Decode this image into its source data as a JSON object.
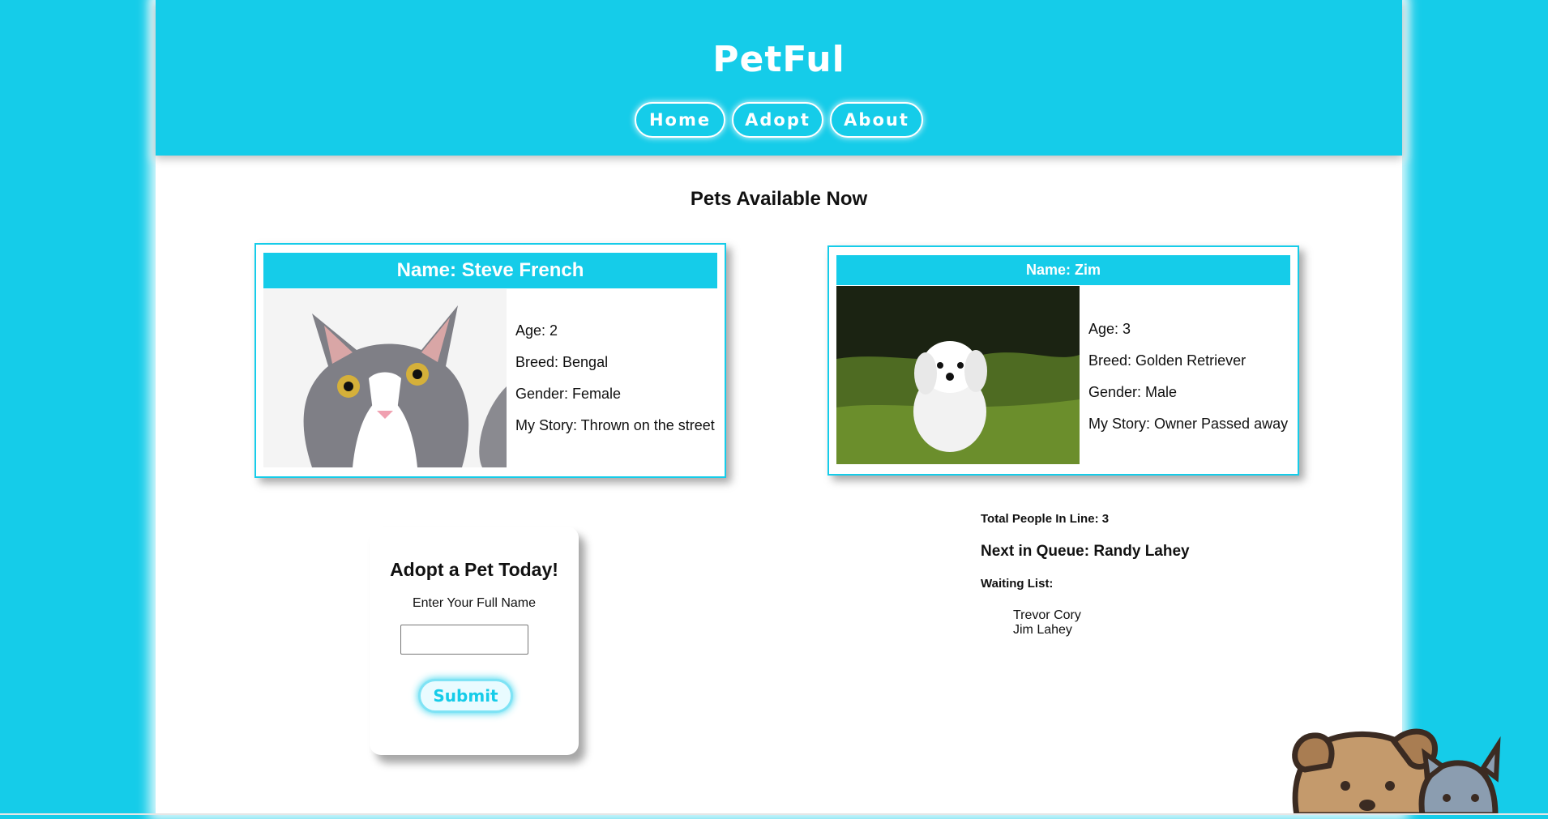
{
  "header": {
    "brand": "PetFul",
    "nav": [
      {
        "label": "Home"
      },
      {
        "label": "Adopt"
      },
      {
        "label": "About"
      }
    ]
  },
  "main": {
    "title": "Pets Available Now",
    "pets": [
      {
        "name_label": "Name: Steve French",
        "photo_icon": "gray-white-cat-photo",
        "age": "Age: 2",
        "breed": "Breed: Bengal",
        "gender": "Gender: Female",
        "story": "My Story: Thrown on the street"
      },
      {
        "name_label": "Name: Zim",
        "photo_icon": "white-puppy-on-grass-photo",
        "age": "Age: 3",
        "breed": "Breed: Golden Retriever",
        "gender": "Gender: Male",
        "story": "My Story: Owner Passed away"
      }
    ],
    "adopt_form": {
      "title": "Adopt a Pet Today!",
      "label": "Enter Your Full Name",
      "input_value": "",
      "submit_label": "Submit"
    },
    "queue": {
      "total": "Total People In Line: 3",
      "next": "Next in Queue: Randy Lahey",
      "waiting_title": "Waiting List:",
      "waiting_list": [
        "Trevor Cory",
        "Jim Lahey"
      ]
    }
  },
  "footer": {
    "art_icon": "dog-and-cat-illustration"
  },
  "colors": {
    "accent": "#15cce9",
    "page_background": "#ffffff"
  }
}
